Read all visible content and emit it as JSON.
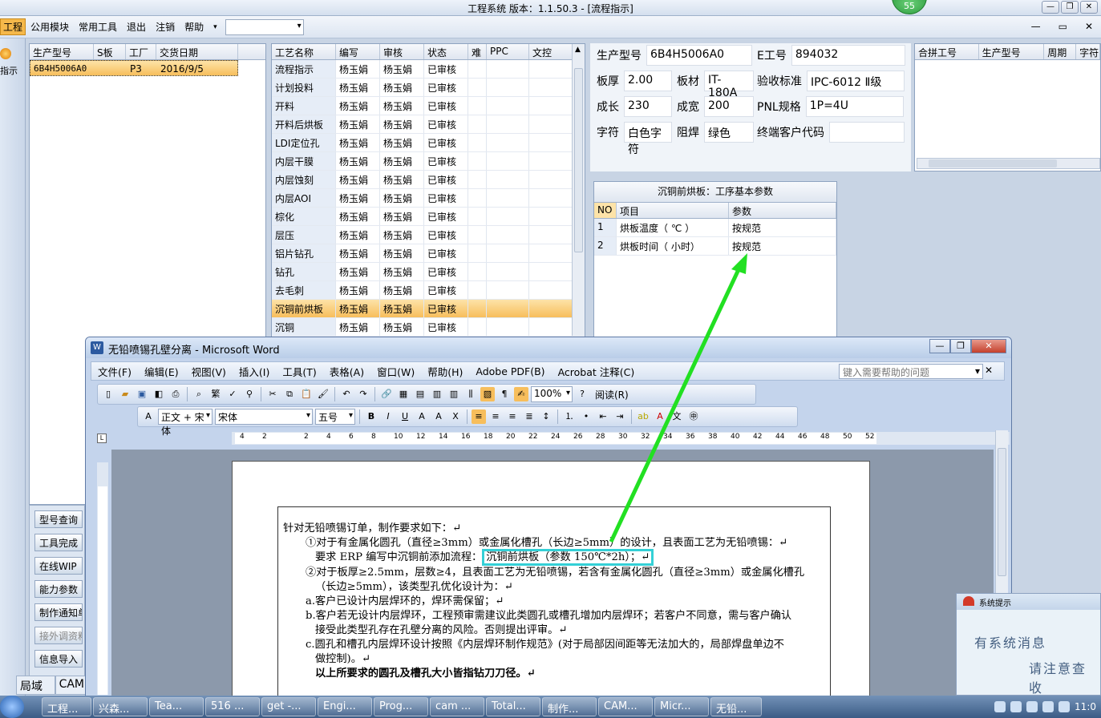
{
  "app": {
    "title": "工程系统    版本：1.1.50.3 - [流程指示]",
    "badge": "55",
    "menu": [
      "工程",
      "公用模块",
      "常用工具",
      "退出",
      "注销",
      "帮助"
    ],
    "left_strip_label": "指示"
  },
  "orders_table": {
    "headers": [
      "生产型号",
      "S板",
      "工厂",
      "交货日期"
    ],
    "rows": [
      [
        "6B4H5006A0",
        "",
        "P3",
        "2016/9/5"
      ]
    ]
  },
  "process_table": {
    "headers": [
      "工艺名称",
      "编写",
      "审核",
      "状态",
      "难",
      "PPC",
      "文控"
    ],
    "rows": [
      [
        "流程指示",
        "杨玉娟",
        "杨玉娟",
        "已审核"
      ],
      [
        "计划投料",
        "杨玉娟",
        "杨玉娟",
        "已审核"
      ],
      [
        "开料",
        "杨玉娟",
        "杨玉娟",
        "已审核"
      ],
      [
        "开料后烘板",
        "杨玉娟",
        "杨玉娟",
        "已审核"
      ],
      [
        "LDI定位孔",
        "杨玉娟",
        "杨玉娟",
        "已审核"
      ],
      [
        "内层干膜",
        "杨玉娟",
        "杨玉娟",
        "已审核"
      ],
      [
        "内层蚀刻",
        "杨玉娟",
        "杨玉娟",
        "已审核"
      ],
      [
        "内层AOI",
        "杨玉娟",
        "杨玉娟",
        "已审核"
      ],
      [
        "棕化",
        "杨玉娟",
        "杨玉娟",
        "已审核"
      ],
      [
        "层压",
        "杨玉娟",
        "杨玉娟",
        "已审核"
      ],
      [
        "铝片钻孔",
        "杨玉娟",
        "杨玉娟",
        "已审核"
      ],
      [
        "钻孔",
        "杨玉娟",
        "杨玉娟",
        "已审核"
      ],
      [
        "去毛刺",
        "杨玉娟",
        "杨玉娟",
        "已审核"
      ],
      [
        "沉铜前烘板",
        "杨玉娟",
        "杨玉娟",
        "已审核"
      ],
      [
        "沉铜",
        "杨玉娟",
        "杨玉娟",
        "已审核"
      ]
    ],
    "selected_index": 13
  },
  "product_info": {
    "model_label": "生产型号",
    "model": "6B4H5006A0",
    "e_label": "E工号",
    "e_no": "894032",
    "thickness_label": "板厚",
    "thickness": "2.00",
    "material_label": "板材",
    "material": "IT-180A",
    "standard_label": "验收标准",
    "standard": "IPC-6012 Ⅱ级",
    "length_label": "成长",
    "length": "230",
    "width_label": "成宽",
    "width": "200",
    "pnl_label": "PNL规格",
    "pnl": "1P=4U",
    "char_label": "字符",
    "char": "白色字符",
    "mask_label": "阻焊",
    "mask": "绿色",
    "customer_label": "终端客户代码",
    "customer": ""
  },
  "merge_table": {
    "headers": [
      "合拼工号",
      "生产型号",
      "周期",
      "字符"
    ]
  },
  "params_panel": {
    "caption": "沉铜前烘板：工序基本参数",
    "headers": [
      "NO",
      "项目",
      "参数"
    ],
    "rows": [
      [
        "1",
        "烘板温度（ ℃ ）",
        "按规范"
      ],
      [
        "2",
        "烘板时间（ 小时）",
        "按规范"
      ]
    ]
  },
  "side_buttons": [
    "型号查询",
    "工具完成",
    "在线WIP",
    "能力参数",
    "制作通知单",
    "接外调资料",
    "信息导入"
  ],
  "lan_tabs": [
    "局域网",
    "CAM"
  ],
  "word": {
    "title": "无铅喷锡孔壁分离 - Microsoft Word",
    "menu": [
      "文件(F)",
      "编辑(E)",
      "视图(V)",
      "插入(I)",
      "工具(T)",
      "表格(A)",
      "窗口(W)",
      "帮助(H)",
      "Adobe PDF(B)",
      "Acrobat 注释(C)"
    ],
    "help_placeholder": "键入需要帮助的问题",
    "zoom": "100%",
    "reading": "阅读(R)",
    "style": "正文 + 宋体",
    "font": "宋体",
    "size": "五号",
    "ruler_ticks": [
      "4",
      "2",
      "2",
      "4",
      "6",
      "8",
      "10",
      "12",
      "14",
      "16",
      "18",
      "20",
      "22",
      "24",
      "26",
      "28",
      "30",
      "32",
      "34",
      "36",
      "38",
      "40",
      "42",
      "44",
      "46",
      "48",
      "50",
      "52"
    ],
    "doc_lines": [
      "针对无铅喷锡订单，制作要求如下：↵",
      "①对于有金属化圆孔（直径≥3mm）或金属化槽孔（长边≥5mm）的设计，且表面工艺为无铅喷锡：↵",
      "要求 ERP 编写中沉铜前添加流程：",
      "沉铜前烘板（参数 150℃*2h）；↵",
      "②对于板厚≥2.5mm，层数≥4，且表面工艺为无铅喷锡，若含有金属化圆孔（直径≥3mm）或金属化槽孔",
      "（长边≥5mm），该类型孔优化设计为：↵",
      "a.客户已设计内层焊环的，焊环需保留；↵",
      "b.客户若无设计内层焊环，工程预审需建议此类圆孔或槽孔增加内层焊环；若客户不同意，需与客户确认",
      "接受此类型孔存在孔壁分离的风险。否则提出评审。↵",
      "c.圆孔和槽孔内层焊环设计按照《内层焊环制作规范》(对于局部因间距等无法加大的，局部焊盘单边不",
      "做控制)。↵",
      "以上所要求的圆孔及槽孔大小皆指钻刀刀径。↵"
    ]
  },
  "system_tip": {
    "header": "系统提示",
    "line1": "有系统消息",
    "line2": "请注意查收"
  },
  "taskbar": {
    "items": [
      "工程...",
      "兴森...",
      "Tea...",
      "516 ...",
      "get -...",
      "Engi...",
      "Prog...",
      "cam ...",
      "Total...",
      "制作...",
      "CAM...",
      "Micr...",
      "无铅..."
    ],
    "clock": "11:0"
  }
}
